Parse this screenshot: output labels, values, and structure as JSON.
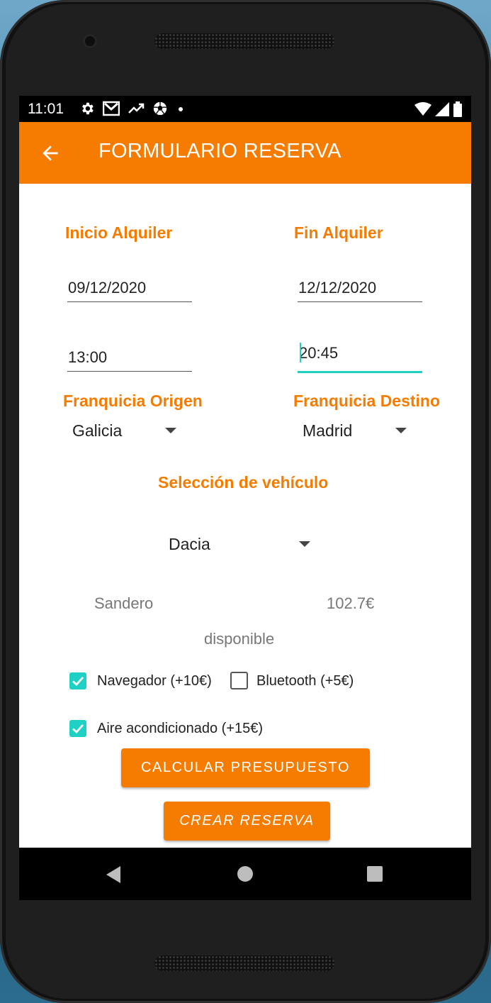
{
  "status_bar": {
    "time": "11:01",
    "notification_icons": [
      "gear-icon",
      "gmail-icon",
      "trending-icon",
      "soccer-ball-icon",
      "dot-icon"
    ],
    "right_icons": [
      "wifi-icon",
      "signal-icon",
      "battery-icon"
    ]
  },
  "app_bar": {
    "title": "FORMULARIO RESERVA",
    "back_icon": "arrow-back-icon"
  },
  "form": {
    "inicio_label": "Inicio Alquiler",
    "fin_label": "Fin Alquiler",
    "inicio_fecha": "09/12/2020",
    "fin_fecha": "12/12/2020",
    "inicio_hora": "13:00",
    "fin_hora": "20:45",
    "franquicia_origen_label": "Franquicia Origen",
    "franquicia_destino_label": "Franquicia Destino",
    "franquicia_origen_value": "Galicia",
    "franquicia_destino_value": "Madrid",
    "vehiculo_label": "Selección de vehículo",
    "vehiculo_value": "Dacia",
    "modelo": "Sandero",
    "precio": "102.7€",
    "disponibilidad": "disponible",
    "extras": [
      {
        "label": "Navegador (+10€)",
        "checked": true
      },
      {
        "label": "Bluetooth (+5€)",
        "checked": false
      },
      {
        "label": "Aire acondicionado (+15€)",
        "checked": true
      }
    ],
    "calcular_button": "CALCULAR PRESUPUESTO",
    "crear_button": "CREAR RESERVA"
  },
  "colors": {
    "accent": "#f57c00",
    "teal": "#1fd0c4"
  }
}
